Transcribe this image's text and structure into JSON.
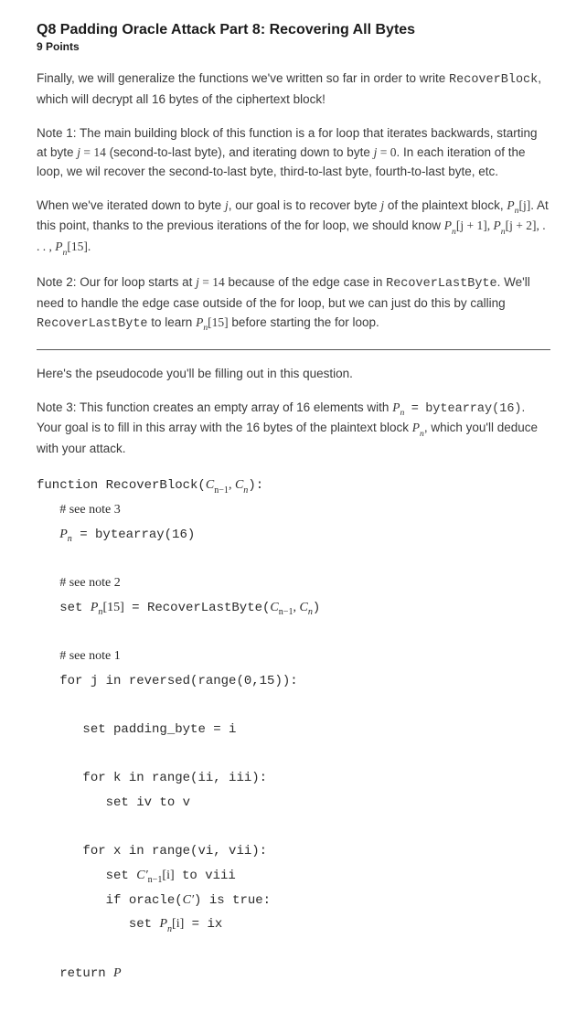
{
  "header": {
    "title": "Q8 Padding Oracle Attack Part 8: Recovering All Bytes",
    "points": "9 Points"
  },
  "paragraphs": {
    "intro": "Finally, we will generalize the functions we've written so far in order to write ",
    "intro_fn": "RecoverBlock",
    "intro2": ", which will decrypt all 16 bytes of the ciphertext block!",
    "note1a": "Note 1: The main building block of this function is a for loop that iterates backwards, starting at byte ",
    "note1b": " (second-to-last byte), and iterating down to byte ",
    "note1c": ". In each iteration of the loop, we wil recover the second-to-last byte, third-to-last byte, fourth-to-last byte, etc.",
    "when1": "When we've iterated down to byte ",
    "when2": ", our goal is to recover byte ",
    "when3": " of the plaintext block, ",
    "when4": ". At this point, thanks to the previous iterations of the for loop, we should know ",
    "note2a": "Note 2: Our for loop starts at ",
    "note2b": " because of the edge case in ",
    "note2_fn1": "RecoverLastByte",
    "note2c": ". We'll need to handle the edge case outside of the for loop, but we can just do this by calling ",
    "note2_fn2": "RecoverLastByte",
    "note2d": " to learn ",
    "note2e": " before starting the for loop.",
    "pseudo_intro": "Here's the pseudocode you'll be filling out in this question.",
    "note3a": "Note 3: This function creates an empty array of 16 elements with ",
    "note3_expr": "bytearray(16)",
    "note3b": ". Your goal is to fill in this array with the 16 bytes of the plaintext block ",
    "note3c": ", which you'll deduce with your attack."
  },
  "math": {
    "j": "j",
    "eq": " = ",
    "v14": "14",
    "v0": "0",
    "P": "P",
    "n": "n",
    "nm1": "n−1",
    "bj": "[j]",
    "bjp1": "[j + 1]",
    "bjp2": "[j + 2]",
    "dots": ", . . . , ",
    "b15": "[15]",
    "bi": "[i]",
    "C": "C",
    "Cp": "C′",
    "comma": ", ",
    "period": ".",
    "comma2": ","
  },
  "code": {
    "fn": "function RecoverBlock(",
    "fn_end": "):",
    "c_note3": "# see note 3",
    "assign_ba": " = bytearray(16)",
    "c_note2": "# see note 2",
    "set": "set ",
    "rlb": " = RecoverLastByte(",
    "rlb_end": ")",
    "c_note1": "# see note 1",
    "forj": "for j in reversed(range(0,15)):",
    "pad": "set padding_byte = i",
    "fork": "for k in range(ii, iii):",
    "setiv": "set iv to v",
    "forx": "for x in range(vi, vii):",
    "setc": "set ",
    "setc2": " to viii",
    "iforacle": "if oracle(",
    "iforacle2": ") is true:",
    "setp": "set ",
    "setp2": " = ix",
    "ret": "return "
  }
}
